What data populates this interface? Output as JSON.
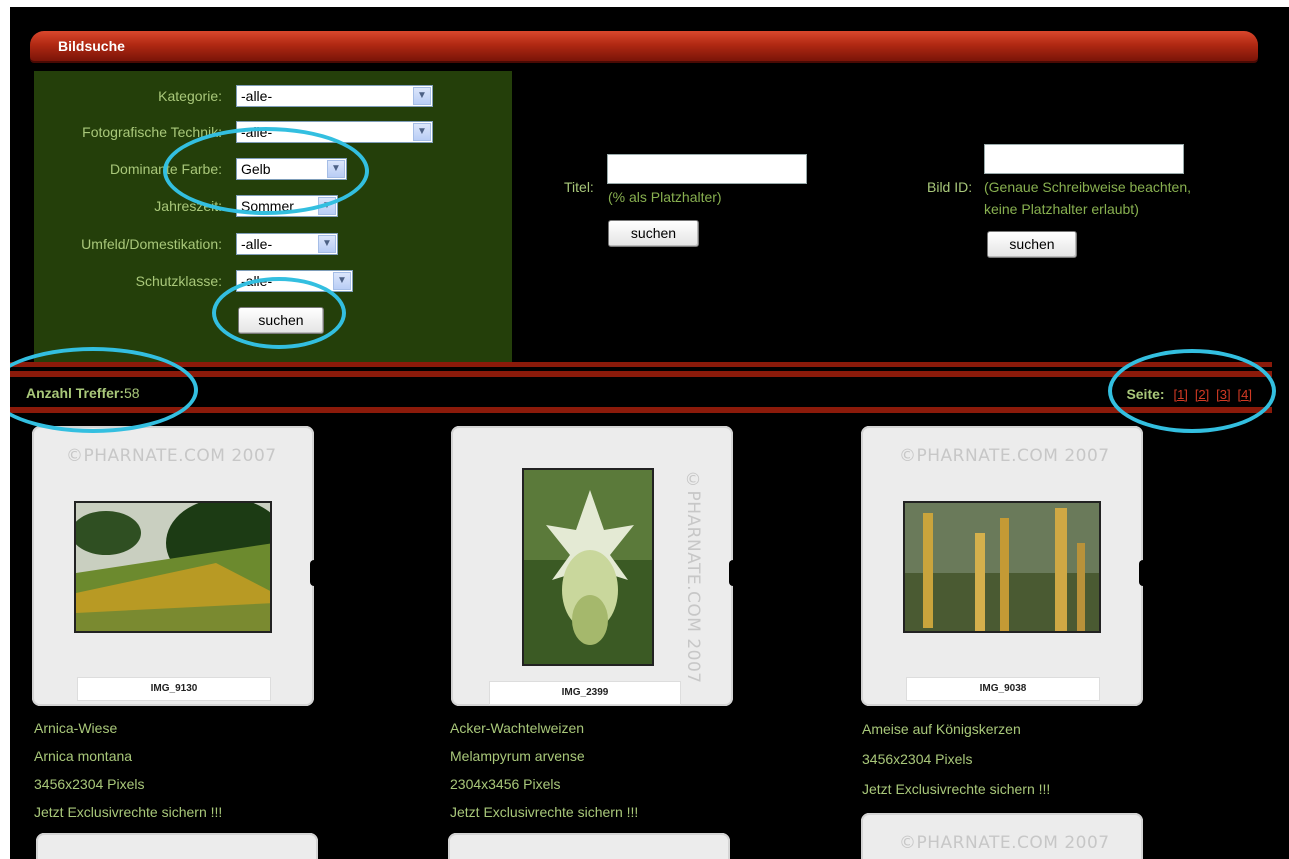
{
  "panel": {
    "title": "Bildsuche"
  },
  "filters": [
    {
      "label": "Kategorie:",
      "value": "-alle-"
    },
    {
      "label": "Fotografische Technik:",
      "value": "-alle-"
    },
    {
      "label": "Dominante Farbe:",
      "value": "Gelb"
    },
    {
      "label": "Jahreszeit:",
      "value": "Sommer"
    },
    {
      "label": "Umfeld/Domestikation:",
      "value": "-alle-"
    },
    {
      "label": "Schutzklasse:",
      "value": "-alle-"
    }
  ],
  "filter_submit": "suchen",
  "title_search": {
    "label": "Titel:",
    "hint": "(% als Platzhalter)",
    "button": "suchen",
    "value": ""
  },
  "id_search": {
    "label": "Bild ID:",
    "hint1": "(Genaue Schreibweise beachten,",
    "hint2": "keine Platzhalter erlaubt)",
    "button": "suchen",
    "value": ""
  },
  "results": {
    "label": "Anzahl Treffer:",
    "count": "58"
  },
  "pager": {
    "label": "Seite:",
    "pages": [
      "[1]",
      "[2]",
      "[3]",
      "[4]"
    ]
  },
  "watermark": "©PHARNATE.COM 2007",
  "items": [
    {
      "caption": "IMG_9130",
      "title": "Arnica-Wiese",
      "latin": "Arnica montana",
      "size": "3456x2304 Pixels",
      "cta": "Jetzt Exclusivrechte sichern !!!"
    },
    {
      "caption": "IMG_2399",
      "title": "Acker-Wachtelweizen",
      "latin": "Melampyrum arvense",
      "size": "2304x3456 Pixels",
      "cta": "Jetzt Exclusivrechte sichern !!!"
    },
    {
      "caption": "IMG_9038",
      "title": "Ameise auf Königskerzen",
      "size": "3456x2304 Pixels",
      "cta": "Jetzt Exclusivrechte sichern !!!"
    }
  ],
  "colors": {
    "panel_green": "#243f0a",
    "accent_red": "#b12913",
    "text_green": "#a9c87a",
    "highlight": "#33bfe0"
  }
}
